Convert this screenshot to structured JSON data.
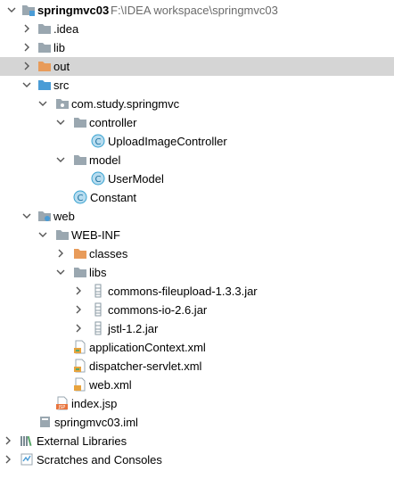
{
  "project_tree": {
    "root": {
      "label": "springmvc03",
      "path": "F:\\IDEA workspace\\springmvc03"
    },
    "idea": "idea",
    "lib": "lib",
    "out": "out",
    "src": "src",
    "package": "com.study.springmvc",
    "controller": "controller",
    "upload_image_controller": "UploadImageController",
    "model": "model",
    "user_model": "UserModel",
    "constant": "Constant",
    "web": "web",
    "web_inf": "WEB-INF",
    "classes": "classes",
    "libs": "libs",
    "jar_fileupload": "commons-fileupload-1.3.3.jar",
    "jar_io": "commons-io-2.6.jar",
    "jar_jstl": "jstl-1.2.jar",
    "application_context": "applicationContext.xml",
    "dispatcher_servlet": "dispatcher-servlet.xml",
    "web_xml": "web.xml",
    "index_jsp": "index.jsp",
    "iml": "springmvc03.iml",
    "external_libraries": "External Libraries",
    "scratches": "Scratches and Consoles"
  },
  "colors": {
    "folder": "#9aa7b0",
    "excluded_folder": "#e89b5a",
    "source_folder": "#4a9cd6",
    "class_icon": "#38a3d1",
    "selection": "#d5d5d5",
    "path_text": "#6b6b6b"
  },
  "icons": {
    "expanded": "chevron-down-icon",
    "collapsed": "chevron-right-icon",
    "folder": "folder-icon",
    "class": "class-icon",
    "jar": "jar-icon",
    "xml": "xml-icon",
    "jsp": "jsp-icon",
    "iml": "module-file-icon",
    "libraries": "libraries-icon",
    "scratches": "scratches-icon"
  }
}
